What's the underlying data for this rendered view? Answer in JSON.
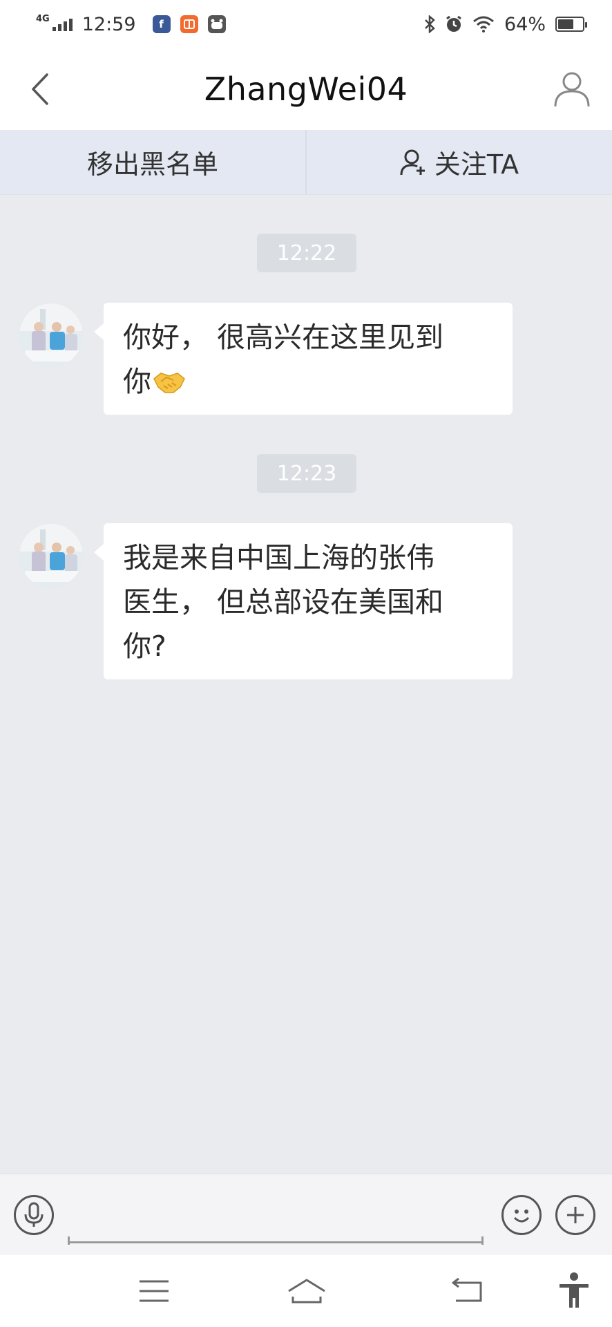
{
  "status_bar": {
    "network": "4G",
    "time": "12:59",
    "battery_percent": "64%",
    "battery_level": 0.64,
    "app_icons": [
      "facebook-icon",
      "orange-app-icon",
      "du-app-icon"
    ],
    "right_icons": [
      "bluetooth-icon",
      "alarm-icon",
      "wifi-icon"
    ]
  },
  "header": {
    "title": "ZhangWei04",
    "back_icon": "chevron-left-icon",
    "profile_icon": "user-icon"
  },
  "actions": {
    "unblock_label": "移出黑名单",
    "follow_label": "关注TA",
    "follow_icon": "user-plus-icon"
  },
  "messages": [
    {
      "time": "12:22",
      "text_line1": "你好， 很高兴在这里见到",
      "text_line2": "你",
      "emoji": "handshake-emoji"
    },
    {
      "time": "12:23",
      "text_line1": "我是来自中国上海的张伟",
      "text_line2": "医生， 但总部设在美国和",
      "text_line3": "你?"
    }
  ],
  "input_bar": {
    "voice_icon": "microphone-icon",
    "emoji_icon": "smiley-icon",
    "plus_icon": "plus-icon",
    "placeholder": ""
  },
  "nav_bar": {
    "icons": [
      "menu-icon",
      "home-icon",
      "back-icon",
      "accessibility-icon"
    ]
  },
  "colors": {
    "background": "#e9ebef",
    "action_bar": "#e3e8f3",
    "time_chip": "#dadde2",
    "bubble": "#ffffff"
  }
}
